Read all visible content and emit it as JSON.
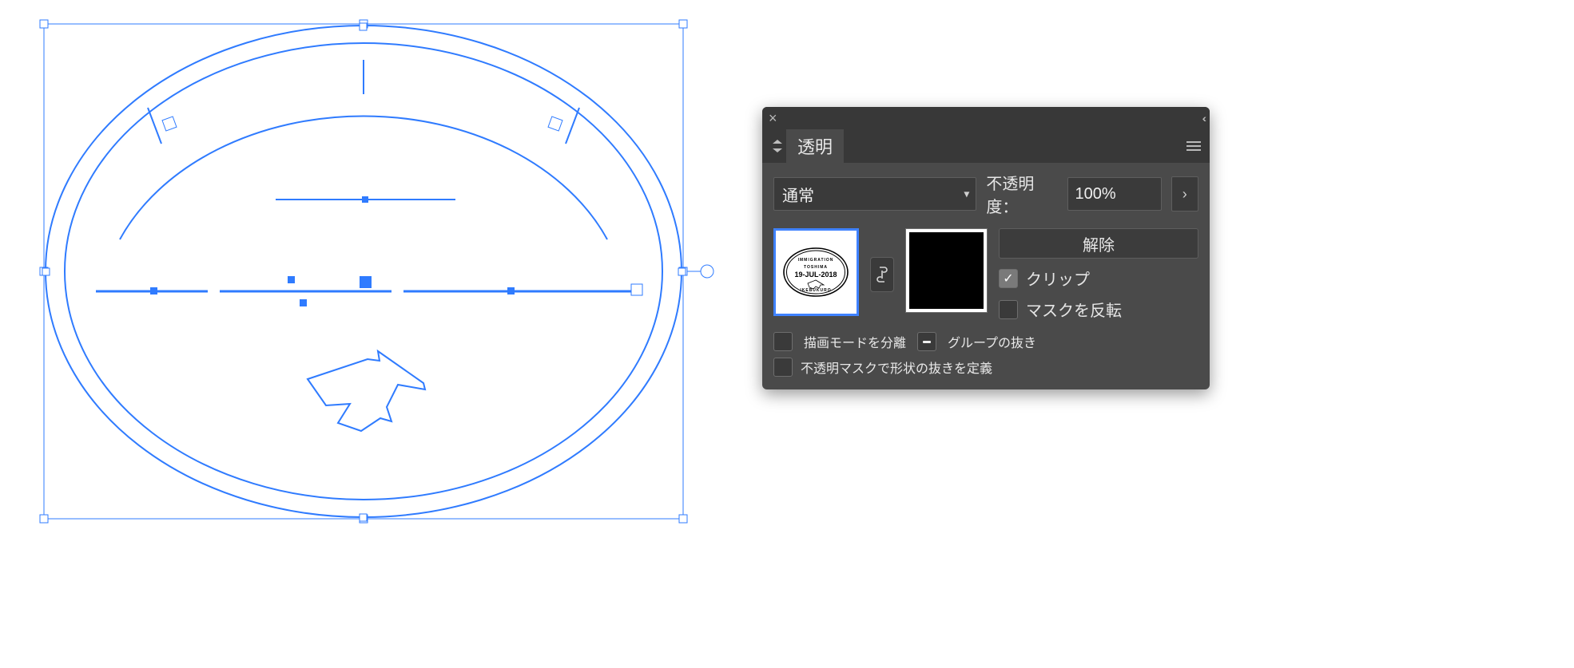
{
  "panel": {
    "title": "透明",
    "blend_mode": "通常",
    "opacity_label": "不透明度：",
    "opacity_value": "100%",
    "release_label": "解除",
    "clip_label": "クリップ",
    "clip_checked": true,
    "invert_label": "マスクを反転",
    "invert_checked": false,
    "isolate_label": "描画モードを分離",
    "isolate_checked": false,
    "knockout_label": "グループの抜き",
    "knockout_state": "mixed",
    "define_knockout_label": "不透明マスクで形状の抜きを定義",
    "define_knockout_checked": false,
    "linked": true,
    "art_selected": true,
    "mask_selected": false
  },
  "stamp": {
    "top_text": "IMMIGRATION",
    "mid_text": "TOSHIMA",
    "date": "19-JUL-2018",
    "bottom_text": "IKEBUKURO"
  },
  "icons": {
    "close": "close-icon",
    "collapse": "collapse-icon",
    "panel_menu": "menu-icon",
    "dropdown": "chevron-down-icon",
    "stepper": "chevron-right-icon",
    "link": "link-icon",
    "tab_arrows": "expand-tab-icon"
  },
  "selection": {
    "shape": "stamp-artwork",
    "selected": true
  }
}
